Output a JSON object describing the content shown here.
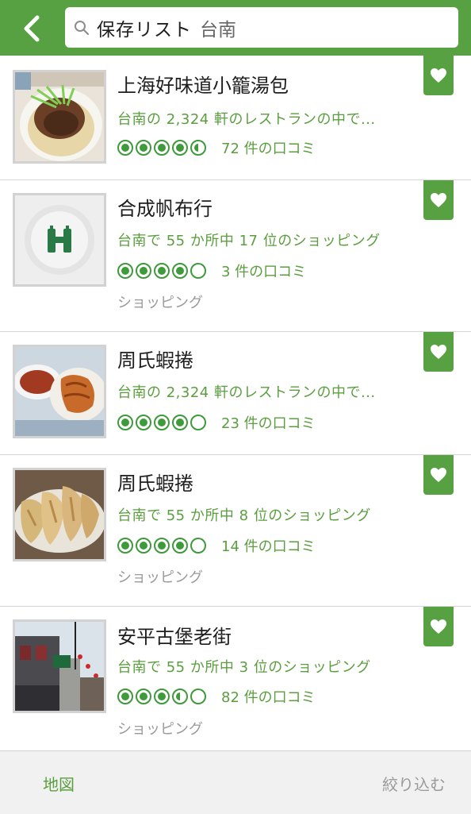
{
  "header": {
    "search_prefix": "保存リスト",
    "search_query": "台南"
  },
  "items": [
    {
      "title": "上海好味道小籠湯包",
      "subtitle": "台南の 2,324 軒のレストランの中で...",
      "rating": 4.5,
      "reviews": "72 件の口コミ",
      "category": ""
    },
    {
      "title": "合成帆布行",
      "subtitle": "台南で 55 か所中 17 位のショッピング",
      "rating": 4,
      "reviews": "3 件の口コミ",
      "category": "ショッピング"
    },
    {
      "title": "周氏蝦捲",
      "subtitle": "台南の 2,324 軒のレストランの中で...",
      "rating": 4,
      "reviews": "23 件の口コミ",
      "category": ""
    },
    {
      "title": "周氏蝦捲",
      "subtitle": "台南で 55 か所中 8 位のショッピング",
      "rating": 4,
      "reviews": "14 件の口コミ",
      "category": "ショッピング"
    },
    {
      "title": "安平古堡老街",
      "subtitle": "台南で 55 か所中 3 位のショッピング",
      "rating": 3.5,
      "reviews": "82 件の口コミ",
      "category": "ショッピング"
    }
  ],
  "bottom": {
    "map_label": "地図",
    "filter_label": "絞り込む"
  },
  "colors": {
    "brand_green": "#58a142",
    "text_green": "#5b9e3f",
    "bubble_green": "#3e9a3a"
  },
  "icons": {
    "back": "chevron-left-icon",
    "search": "search-icon",
    "save": "heart-icon",
    "placeholder": "binoculars-icon"
  }
}
